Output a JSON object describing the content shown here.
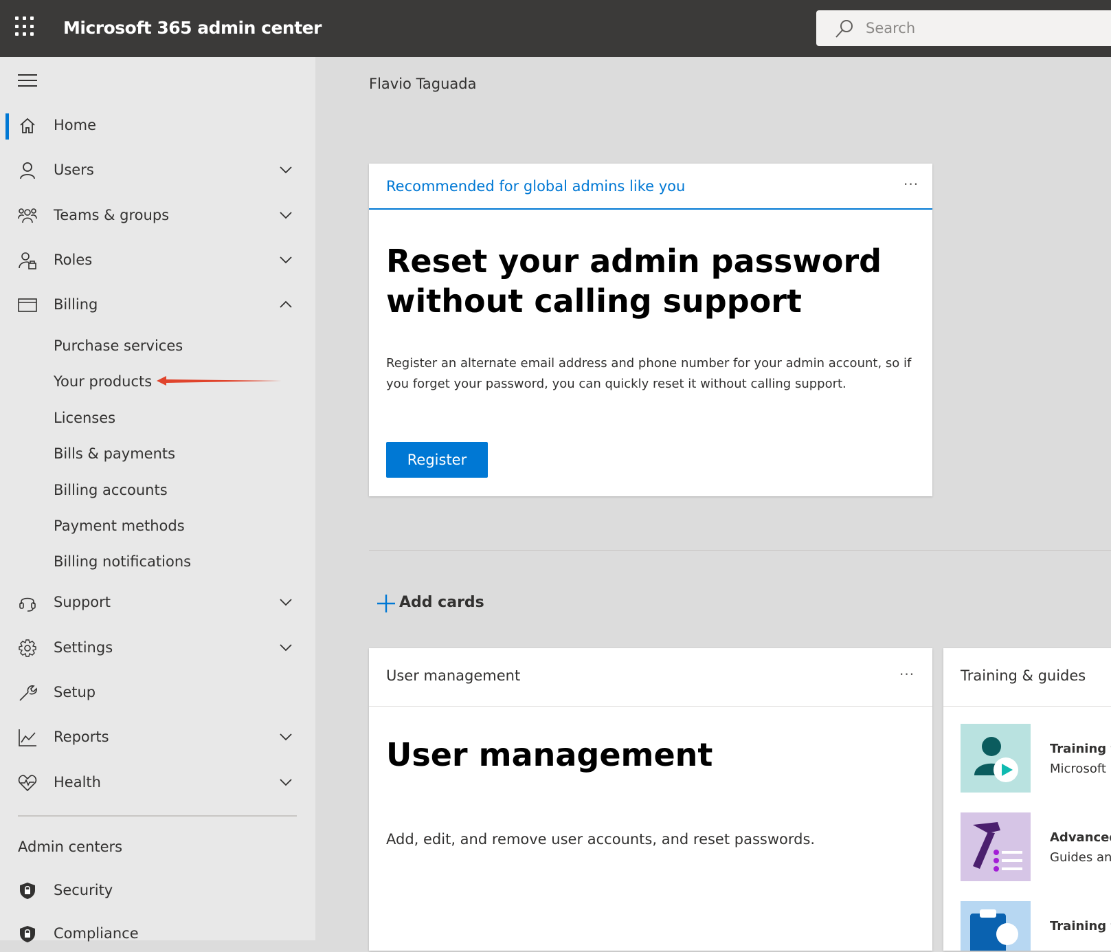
{
  "header": {
    "app_title": "Microsoft 365 admin center",
    "search_placeholder": "Search"
  },
  "sidebar": {
    "items": [
      {
        "label": "Home",
        "icon": "home-icon"
      },
      {
        "label": "Users",
        "icon": "user-icon"
      },
      {
        "label": "Teams & groups",
        "icon": "teams-groups-icon"
      },
      {
        "label": "Roles",
        "icon": "roles-icon"
      },
      {
        "label": "Billing",
        "icon": "billing-card-icon"
      },
      {
        "label": "Support",
        "icon": "headset-icon"
      },
      {
        "label": "Settings",
        "icon": "gear-icon"
      },
      {
        "label": "Setup",
        "icon": "wrench-icon"
      },
      {
        "label": "Reports",
        "icon": "chart-icon"
      },
      {
        "label": "Health",
        "icon": "heart-pulse-icon"
      }
    ],
    "billing_sub": [
      "Purchase services",
      "Your products",
      "Licenses",
      "Bills & payments",
      "Billing accounts",
      "Payment methods",
      "Billing notifications"
    ],
    "admin_centers_heading": "Admin centers",
    "admin_centers": [
      "Security",
      "Compliance"
    ]
  },
  "main": {
    "user_name": "Flavio Taguada",
    "recommended_card": {
      "header": "Recommended for global admins like you",
      "more": "···",
      "title": "Reset your admin password without calling support",
      "description": "Register an alternate email address and phone number for your admin account, so if you forget your password, you can quickly reset it without calling support.",
      "button": "Register"
    },
    "add_cards": "Add cards",
    "user_mgmt_card": {
      "header": "User management",
      "more": "···",
      "title": "User management",
      "description": "Add, edit, and remove user accounts, and reset passwords."
    },
    "training_card": {
      "header": "Training & guides",
      "items": [
        {
          "line1": "Training f",
          "line2": "Microsoft"
        },
        {
          "line1": "Advanced",
          "line2": "Guides an"
        },
        {
          "line1": "Training f",
          "line2": ""
        }
      ]
    }
  },
  "colors": {
    "accent": "#0078d4",
    "topbar": "#3b3a39",
    "annotation_arrow": "#e0442c"
  }
}
